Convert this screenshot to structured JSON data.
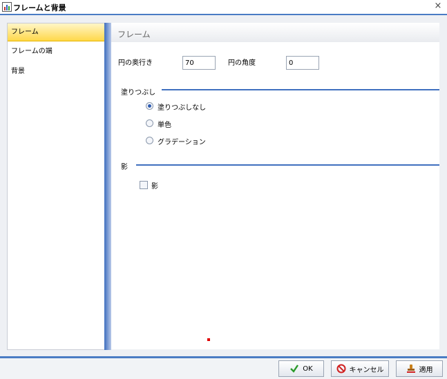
{
  "window": {
    "title": "フレームと背景",
    "close_glyph": "×"
  },
  "sidebar": {
    "items": [
      {
        "label": "フレーム",
        "active": true
      },
      {
        "label": "フレームの端",
        "active": false
      },
      {
        "label": "背景",
        "active": false
      }
    ]
  },
  "content": {
    "title": "フレーム",
    "depth_label": "円の奥行き",
    "depth_value": "70",
    "angle_label": "円の角度",
    "angle_value": "0",
    "fill_section": {
      "label": "塗りつぶし",
      "options": [
        {
          "label": "塗りつぶしなし",
          "checked": true
        },
        {
          "label": "単色",
          "checked": false
        },
        {
          "label": "グラデーション",
          "checked": false
        }
      ]
    },
    "shadow_section": {
      "label": "影",
      "checkbox_label": "影",
      "checked": false
    }
  },
  "footer": {
    "ok_label": "OK",
    "cancel_label": "キャンセル",
    "apply_label": "適用"
  },
  "colors": {
    "accent": "#3f6fbf",
    "active_item": "#ffd84a"
  }
}
